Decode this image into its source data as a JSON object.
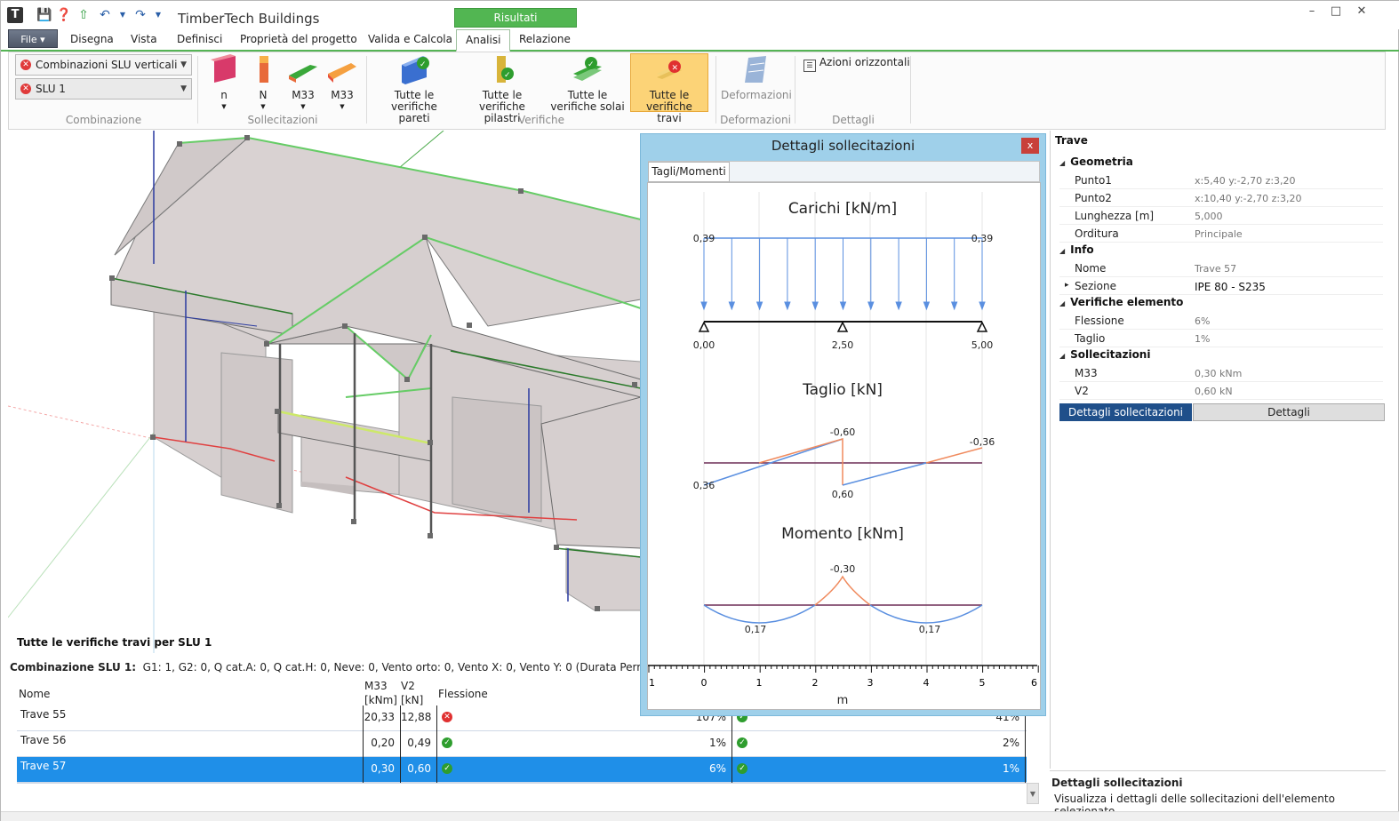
{
  "window": {
    "title": "TimberTech Buildings",
    "context_tab": "Risultati"
  },
  "menu": {
    "file_label": "File",
    "tabs": [
      "Disegna",
      "Vista",
      "Definisci",
      "Proprietà del progetto",
      "Valida e Calcola",
      "Analisi",
      "Relazione"
    ],
    "active_tab": "Analisi"
  },
  "ribbon": {
    "combination": {
      "combo1": "Combinazioni SLU verticali",
      "combo2": "SLU 1",
      "group_label": "Combinazione"
    },
    "stresses": {
      "buttons": [
        "n",
        "N",
        "M33",
        "M33"
      ],
      "group_label": "Sollecitazioni"
    },
    "checks": {
      "walls": "Tutte le verifiche pareti",
      "columns": "Tutte le verifiche pilastri",
      "floors": "Tutte le verifiche solai",
      "beams": "Tutte le verifiche travi",
      "group_label": "Verifiche"
    },
    "deform": {
      "button": "Deformazioni",
      "group_label": "Deformazioni"
    },
    "details": {
      "button": "Azioni orizzontali",
      "group_label": "Dettagli"
    }
  },
  "viewport": {
    "caption": "Tutte le verifiche travi per SLU 1"
  },
  "combination_line": {
    "label": "Combinazione SLU 1:",
    "text": "G1: 1, G2: 0, Q cat.A: 0, Q cat.H: 0, Neve: 0, Vento orto: 0, Vento X: 0, Vento Y: 0 (Durata Permanente)"
  },
  "table": {
    "headers": {
      "name": "Nome",
      "m33": "M33",
      "m33_unit": "[kNm]",
      "v2": "V2",
      "v2_unit": "[kN]",
      "flex": "Flessione"
    },
    "rows": [
      {
        "name": "Trave 55",
        "m33": "20,33",
        "v2": "12,88",
        "flex_ok": false,
        "flex": "107%",
        "shear_ok": true,
        "shear": "41%"
      },
      {
        "name": "Trave 56",
        "m33": "0,20",
        "v2": "0,49",
        "flex_ok": true,
        "flex": "1%",
        "shear_ok": true,
        "shear": "2%"
      },
      {
        "name": "Trave 57",
        "m33": "0,30",
        "v2": "0,60",
        "flex_ok": true,
        "flex": "6%",
        "shear_ok": true,
        "shear": "1%"
      }
    ]
  },
  "dialog": {
    "title": "Dettagli sollecitazioni",
    "close": "x",
    "tab": "Tagli/Momenti",
    "loads_title": "Carichi [kN/m]",
    "load_left": "0,39",
    "load_right": "0,39",
    "supports": [
      "0,00",
      "2,50",
      "5,00"
    ],
    "shear_title": "Taglio [kN]",
    "shear_labels": {
      "top_mid": "-0,60",
      "bottom_mid": "0,60",
      "left": "0,36",
      "right": "-0,36"
    },
    "moment_title": "Momento [kNm]",
    "moment_labels": {
      "peak": "-0,30",
      "left": "0,17",
      "right": "0,17"
    },
    "x_ticks": [
      "1",
      "0",
      "1",
      "2",
      "3",
      "4",
      "5",
      "6"
    ],
    "x_unit": "m"
  },
  "properties": {
    "header": "Trave",
    "sections": [
      {
        "title": "Geometria",
        "rows": [
          [
            "Punto1",
            "x:5,40 y:-2,70 z:3,20"
          ],
          [
            "Punto2",
            "x:10,40 y:-2,70 z:3,20"
          ],
          [
            "Lunghezza [m]",
            "5,000"
          ],
          [
            "Orditura",
            "Principale"
          ]
        ]
      },
      {
        "title": "Info",
        "rows": [
          [
            "Nome",
            "Trave 57"
          ],
          [
            "Sezione",
            "IPE 80 - S235"
          ]
        ]
      },
      {
        "title": "Verifiche elemento",
        "rows": [
          [
            "Flessione",
            "6%"
          ],
          [
            "Taglio",
            "1%"
          ]
        ]
      },
      {
        "title": "Sollecitazioni",
        "rows": [
          [
            "M33",
            "0,30 kNm"
          ],
          [
            "V2",
            "0,60 kN"
          ]
        ]
      }
    ],
    "selected_row": {
      "key": "Dettagli sollecitazioni",
      "button": "Dettagli"
    }
  },
  "hint": {
    "title": "Dettagli sollecitazioni",
    "text": "Visualizza i dettagli delle sollecitazioni dell'elemento selezionato"
  },
  "colors": {
    "accent_green": "#55b455",
    "selection_blue": "#1f8fe8",
    "ok_green": "#2e9d2e",
    "error_red": "#e03030",
    "shear_orange": "#f08a5d",
    "shear_blue": "#5a8fe0"
  }
}
